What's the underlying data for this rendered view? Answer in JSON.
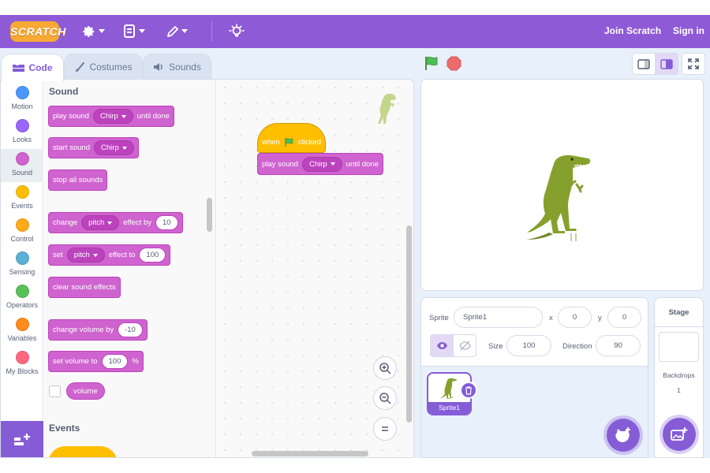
{
  "menubar": {
    "logo": "SCRATCH",
    "join": "Join Scratch",
    "signin": "Sign in"
  },
  "tabs": {
    "code": "Code",
    "costumes": "Costumes",
    "sounds": "Sounds"
  },
  "categories": [
    {
      "label": "Motion",
      "color": "#4c97ff"
    },
    {
      "label": "Looks",
      "color": "#9966ff"
    },
    {
      "label": "Sound",
      "color": "#cf63cf"
    },
    {
      "label": "Events",
      "color": "#ffbf00"
    },
    {
      "label": "Control",
      "color": "#ffab19"
    },
    {
      "label": "Sensing",
      "color": "#5cb1d6"
    },
    {
      "label": "Operators",
      "color": "#59c059"
    },
    {
      "label": "Variables",
      "color": "#ff8c1a"
    },
    {
      "label": "My Blocks",
      "color": "#ff6680"
    }
  ],
  "palette": {
    "sound_title": "Sound",
    "events_title": "Events",
    "play_until_done": {
      "pre": "play sound",
      "sound": "Chirp",
      "post": "until done"
    },
    "start_sound": {
      "pre": "start sound",
      "sound": "Chirp"
    },
    "stop_all": "stop all sounds",
    "change_effect": {
      "pre": "change",
      "effect": "pitch",
      "mid": "effect by",
      "value": "10"
    },
    "set_effect": {
      "pre": "set",
      "effect": "pitch",
      "mid": "effect to",
      "value": "100"
    },
    "clear_effects": "clear sound effects",
    "change_volume": {
      "pre": "change volume by",
      "value": "-10"
    },
    "set_volume": {
      "pre": "set volume to",
      "value": "100",
      "post": "%"
    },
    "volume": "volume"
  },
  "script": {
    "hat": {
      "pre": "when",
      "post": "clicked"
    },
    "block": {
      "pre": "play sound",
      "sound": "Chirp",
      "post": "until done"
    }
  },
  "sprite_info": {
    "sprite_label": "Sprite",
    "sprite_name": "Sprite1",
    "x_label": "x",
    "x_value": "0",
    "y_label": "y",
    "y_value": "0",
    "size_label": "Size",
    "size_value": "100",
    "direction_label": "Direction",
    "direction_value": "90"
  },
  "sprites": [
    {
      "name": "Sprite1"
    }
  ],
  "stage_pane": {
    "title": "Stage",
    "backdrops_label": "Backdrops",
    "backdrops_count": "1"
  },
  "colors": {
    "menu": "#8f5ad6",
    "accent": "#855cd6",
    "sound_block": "#cf63cf",
    "events_block": "#ffbf00",
    "green_flag": "#4cbf56",
    "stop": "#ec6b6b",
    "dino": "#86a02d"
  }
}
